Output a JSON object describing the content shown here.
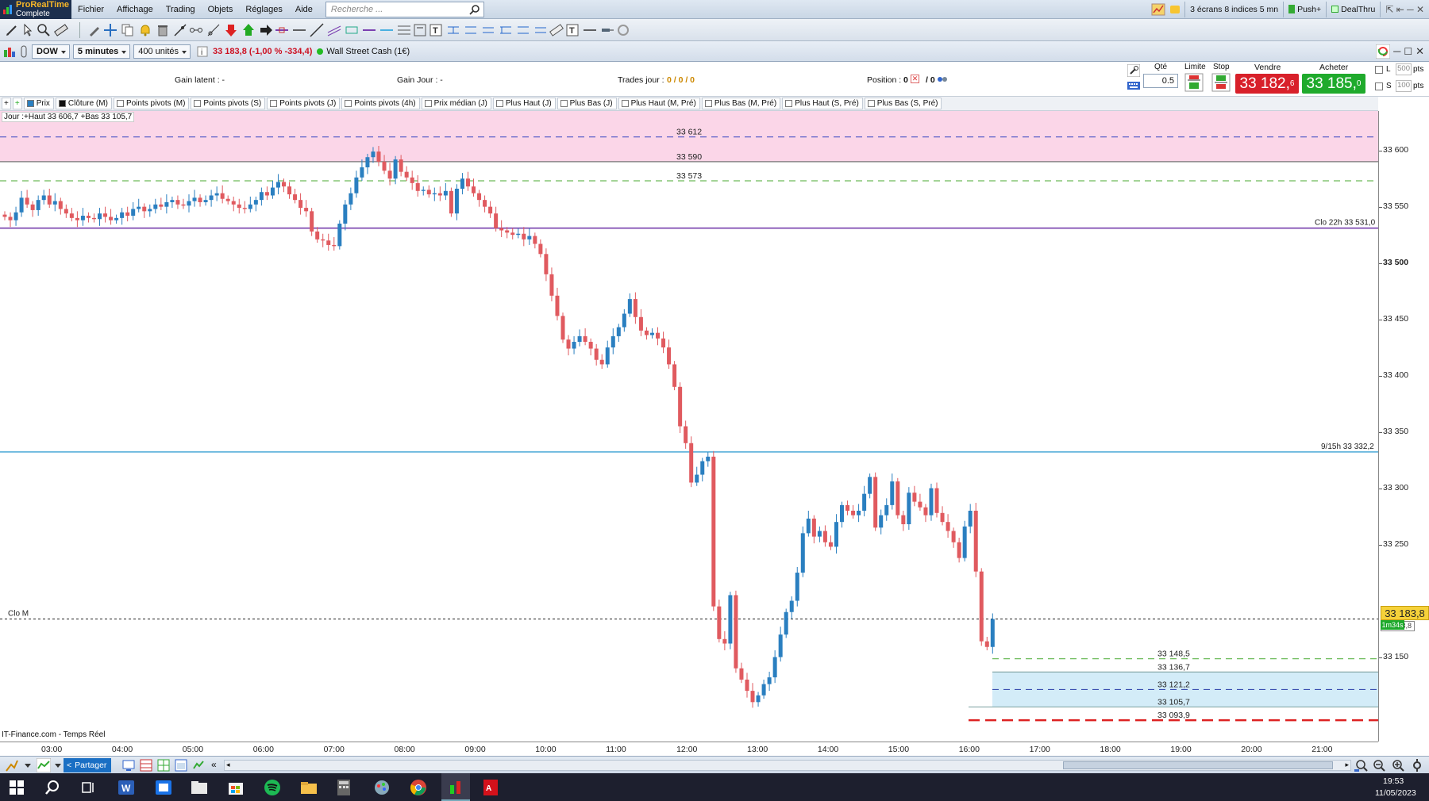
{
  "app": {
    "logo_line1": "ProRealTime",
    "logo_line2": "Complete",
    "menu": [
      "Fichier",
      "Affichage",
      "Trading",
      "Objets",
      "Réglages",
      "Aide"
    ],
    "search_placeholder": "Recherche ...",
    "right_items": [
      "3 écrans 8 indices 5 mn",
      "Push+",
      "DealThru"
    ]
  },
  "instrument": {
    "ticker": "DOW",
    "timeframe": "5 minutes",
    "units": "400 unités",
    "quote": "33 183,8 (-1,00 % -334,4)",
    "name": "Wall Street Cash (1€)"
  },
  "order_panel": {
    "gain_latent": "Gain latent : -",
    "gain_jour": "Gain Jour : -",
    "trades_label": "Trades jour :",
    "trades_value": "0 / 0 / 0",
    "position_label": "Position :",
    "position_value": "0",
    "position_value2": "/ 0",
    "qte_label": "Qté",
    "qte_value": "0.5",
    "limite_label": "Limite",
    "stop_label": "Stop",
    "vendre_label": "Vendre",
    "vendre_price": "33 182,",
    "vendre_sup": "6",
    "acheter_label": "Acheter",
    "acheter_price": "33 185,",
    "acheter_sup": "0",
    "l_label": "L",
    "l_value": "500",
    "s_label": "S",
    "s_value": "100",
    "pts": "pts"
  },
  "indicators": [
    {
      "label": "Prix",
      "checked": true,
      "color": "#2a7fc0"
    },
    {
      "label": "Clôture (M)",
      "checked": true,
      "color": "#111"
    },
    {
      "label": "Points pivots (M)",
      "checked": false
    },
    {
      "label": "Points pivots (S)",
      "checked": false
    },
    {
      "label": "Points pivots (J)",
      "checked": false
    },
    {
      "label": "Points pivots (4h)",
      "checked": false
    },
    {
      "label": "Prix médian (J)",
      "checked": false
    },
    {
      "label": "Plus Haut (J)",
      "checked": false
    },
    {
      "label": "Plus Bas (J)",
      "checked": false
    },
    {
      "label": "Plus Haut (M, Pré)",
      "checked": false
    },
    {
      "label": "Plus Bas (M, Pré)",
      "checked": false
    },
    {
      "label": "Plus Haut (S, Pré)",
      "checked": false
    },
    {
      "label": "Plus Bas (S, Pré)",
      "checked": false
    }
  ],
  "chart_info": {
    "day_info": "Jour :+Haut 33 606,7 +Bas 33 105,7",
    "source": "IT-Finance.com - Temps Réel",
    "clo_m": "Clo M",
    "clo_22h": "Clo 22h 33 531,0",
    "clo_915": "9/15h 33 332,2",
    "current_price": "33 183,8",
    "countdown": "1m34s",
    "price_tag_small": "33 183,8"
  },
  "levels": [
    {
      "label": "33 612",
      "value": 33612,
      "color": "#5a5fc8",
      "style": "dash"
    },
    {
      "label": "33 590",
      "value": 33590,
      "color": "#777",
      "style": "solid"
    },
    {
      "label": "33 573",
      "value": 33573,
      "color": "#6dbb5a",
      "style": "dash"
    },
    {
      "label": "33 148,5",
      "value": 33148.5,
      "color": "#6dbb5a",
      "style": "dash"
    },
    {
      "label": "33 136,7",
      "value": 33136.7,
      "color": "#8aa",
      "style": "solid"
    },
    {
      "label": "33 121,2",
      "value": 33121.2,
      "color": "#3a4fb0",
      "style": "dash"
    },
    {
      "label": "33 105,7",
      "value": 33105.7,
      "color": "#8aa",
      "style": "solid"
    },
    {
      "label": "33 093,9",
      "value": 33093.9,
      "color": "#d22",
      "style": "dash"
    }
  ],
  "chart_data": {
    "type": "candlestick",
    "instrument": "Wall Street Cash (1€)",
    "timeframe": "5 minutes",
    "x_ticks": [
      "03:00",
      "04:00",
      "05:00",
      "06:00",
      "07:00",
      "08:00",
      "09:00",
      "10:00",
      "11:00",
      "12:00",
      "13:00",
      "14:00",
      "15:00",
      "16:00",
      "17:00",
      "18:00",
      "19:00",
      "20:00",
      "21:00"
    ],
    "y_ticks": [
      33600,
      33550,
      33500,
      33450,
      33400,
      33350,
      33300,
      33250,
      33150
    ],
    "y_tick_labels": [
      "33 600",
      "33 550",
      "33 500",
      "33 450",
      "33 400",
      "33 350",
      "33 300",
      "33 250",
      "33 150"
    ],
    "ylim": [
      33075,
      33635
    ],
    "reference_lines": [
      {
        "name": "Clo 22h",
        "value": 33531.0,
        "color": "#6b2fa6"
      },
      {
        "name": "9/15h",
        "value": 33332.2,
        "color": "#4aa8d6"
      },
      {
        "name": "Clo M",
        "value": 33183.8,
        "color": "#222"
      }
    ],
    "zones": [
      {
        "from": 33590,
        "to": 33635,
        "color": "#fbd6e8"
      },
      {
        "from": 33105.7,
        "to": 33136.7,
        "color": "#d3ecf8"
      }
    ],
    "closes": [
      33541,
      33538,
      33545,
      33558,
      33552,
      33547,
      33556,
      33560,
      33552,
      33555,
      33548,
      33544,
      33540,
      33538,
      33542,
      33540,
      33539,
      33544,
      33541,
      33538,
      33540,
      33545,
      33542,
      33548,
      33550,
      33546,
      33548,
      33552,
      33550,
      33554,
      33556,
      33552,
      33551,
      33555,
      33558,
      33554,
      33556,
      33560,
      33562,
      33557,
      33555,
      33552,
      33549,
      33548,
      33552,
      33556,
      33563,
      33560,
      33567,
      33572,
      33568,
      33561,
      33556,
      33549,
      33546,
      33528,
      33521,
      33520,
      33516,
      33515,
      33535,
      33552,
      33562,
      33576,
      33585,
      33594,
      33599,
      33590,
      33582,
      33575,
      33592,
      33581,
      33576,
      33571,
      33564,
      33565,
      33561,
      33562,
      33560,
      33564,
      33544,
      33566,
      33575,
      33568,
      33562,
      33556,
      33550,
      33544,
      33531,
      33529,
      33527,
      33525,
      33526,
      33521,
      33524,
      33517,
      33508,
      33490,
      33471,
      33453,
      33432,
      33424,
      33430,
      33435,
      33430,
      33424,
      33414,
      33410,
      33425,
      33435,
      33443,
      33455,
      33468,
      33452,
      33440,
      33436,
      33438,
      33433,
      33425,
      33410,
      33390,
      33355,
      33340,
      33305,
      33312,
      33324,
      33328,
      33195,
      33166,
      33162,
      33205,
      33140,
      33130,
      33120,
      33110,
      33116,
      33126,
      33132,
      33150,
      33170,
      33190,
      33200,
      33225,
      33260,
      33273,
      33257,
      33262,
      33252,
      33248,
      33270,
      33285,
      33280,
      33276,
      33280,
      33295,
      33310,
      33265,
      33276,
      33285,
      33306,
      33276,
      33268,
      33296,
      33288,
      33283,
      33276,
      33300,
      33278,
      33270,
      33262,
      33252,
      33238,
      33266,
      33280,
      33226,
      33164,
      33159,
      33183.8
    ]
  }
}
